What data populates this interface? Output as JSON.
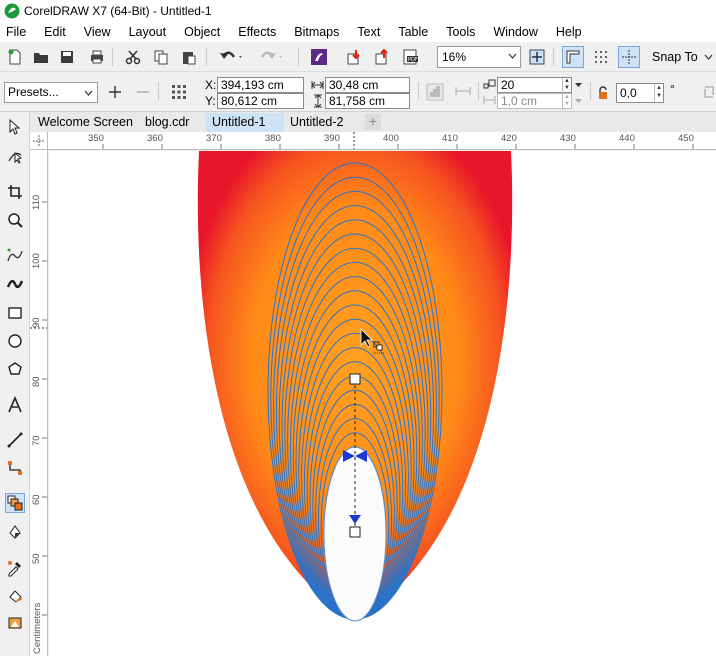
{
  "window": {
    "title": "CorelDRAW X7 (64-Bit) - Untitled-1"
  },
  "menu": [
    "File",
    "Edit",
    "View",
    "Layout",
    "Object",
    "Effects",
    "Bitmaps",
    "Text",
    "Table",
    "Tools",
    "Window",
    "Help"
  ],
  "toolbar": {
    "zoom": "16%",
    "snap_label": "Snap To"
  },
  "property_bar": {
    "presets": "Presets...",
    "x_label": "X:",
    "x_value": "394,193 cm",
    "y_label": "Y:",
    "y_value": "80,612 cm",
    "width_value": "30,48 cm",
    "height_value": "81,758 cm",
    "steps_value": "20",
    "offset_value": "1,0 cm",
    "angle_value": "0,0",
    "angle_unit": "°"
  },
  "tabs": [
    {
      "label": "Welcome Screen",
      "active": false
    },
    {
      "label": "blog.cdr",
      "active": false
    },
    {
      "label": "Untitled-1",
      "active": true
    },
    {
      "label": "Untitled-2",
      "active": false
    }
  ],
  "ruler": {
    "h_labels": [
      "350",
      "360",
      "370",
      "380",
      "390",
      "400",
      "410",
      "420",
      "430",
      "440",
      "450"
    ],
    "v_labels": [
      "110",
      "100",
      "90",
      "80",
      "70",
      "60",
      "50"
    ],
    "units": "Centimeters"
  },
  "icons": {
    "tools": [
      "pick-tool-icon",
      "shape-tool-icon",
      "crop-tool-icon",
      "zoom-tool-icon",
      "freehand-tool-icon",
      "artistic-media-icon",
      "rectangle-tool-icon",
      "ellipse-tool-icon",
      "polygon-tool-icon",
      "text-tool-icon",
      "dimension-tool-icon",
      "connector-tool-icon",
      "blend-tool-icon",
      "transparency-tool-icon",
      "eyedropper-tool-icon",
      "interactive-fill-icon",
      "smart-fill-icon"
    ]
  },
  "colors": {
    "accent": "#cfe3f6",
    "blend_stroke": "#2a74c9",
    "outer_fill_center": "#ffa020",
    "outer_fill_edge": "#e8162a"
  }
}
